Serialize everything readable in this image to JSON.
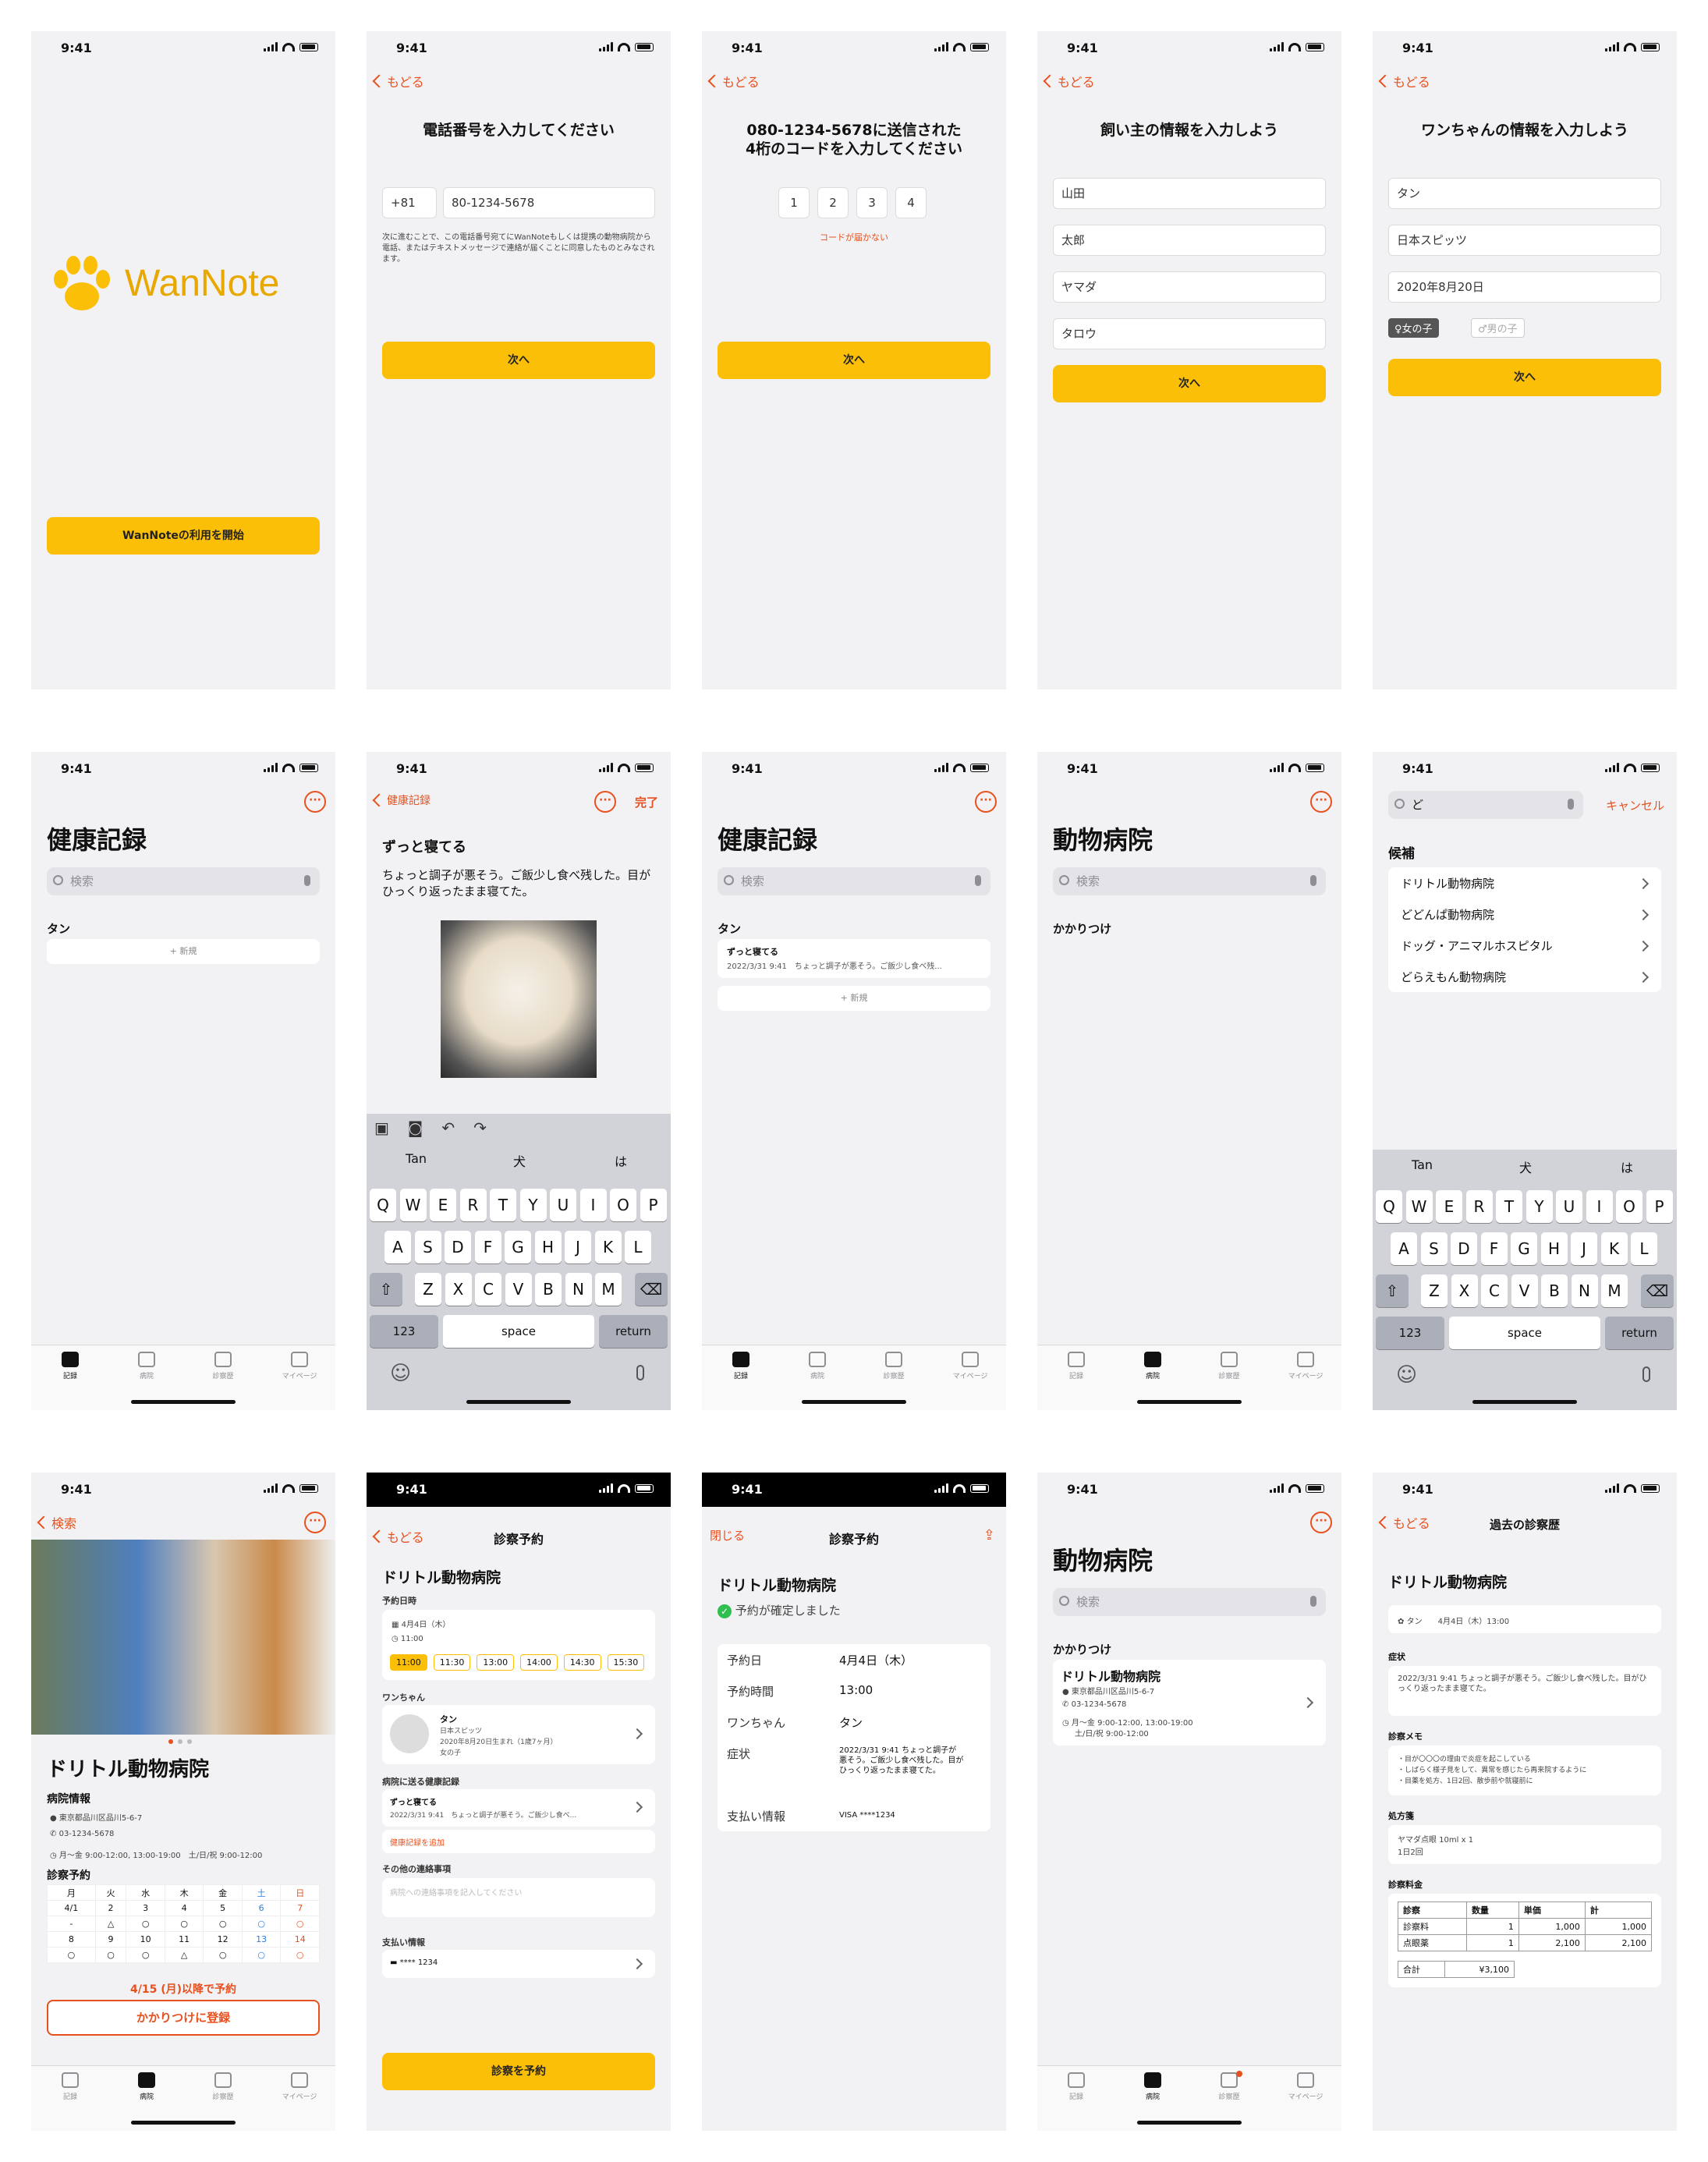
{
  "status_time": "9:41",
  "s1": {
    "logo": "WanNote",
    "start": "WanNoteの利用を開始"
  },
  "s2": {
    "back": "もどる",
    "title": "電話番号を入力してください",
    "code": "+81",
    "phone": "80-1234-5678",
    "notice": "次に進むことで、この電話番号宛てにWanNoteもしくは提携の動物病院から電話、またはテキストメッセージで連絡が届くことに同意したものとみなされます。",
    "next": "次へ"
  },
  "s3": {
    "back": "もどる",
    "title1": "080-1234-5678に送信された",
    "title2": "4桁のコードを入力してください",
    "digits": [
      "1",
      "2",
      "3",
      "4"
    ],
    "resend": "コードが届かない",
    "next": "次へ"
  },
  "s4": {
    "back": "もどる",
    "title": "飼い主の情報を入力しよう",
    "fields": [
      "山田",
      "太郎",
      "ヤマダ",
      "タロウ"
    ],
    "next": "次へ"
  },
  "s5": {
    "back": "もどる",
    "title": "ワンちゃんの情報を入力しよう",
    "fields": [
      "タン",
      "日本スピッツ",
      "2020年8月20日"
    ],
    "female": "♀女の子",
    "male": "♂男の子",
    "next": "次へ"
  },
  "tabs": [
    "記録",
    "病院",
    "診察歴",
    "マイページ"
  ],
  "s6": {
    "title": "健康記録",
    "search": "検索",
    "pet": "タン",
    "new": "+ 新規"
  },
  "s7": {
    "back": "健康記録",
    "done": "完了",
    "heading": "ずっと寝てる",
    "body": "ちょっと調子が悪そう。ご飯少し食べ残した。目がひっくり返ったまま寝てた。",
    "sugg": [
      "Tan",
      "犬",
      "は"
    ]
  },
  "kb": {
    "row1": [
      "Q",
      "W",
      "E",
      "R",
      "T",
      "Y",
      "U",
      "I",
      "O",
      "P"
    ],
    "row2": [
      "A",
      "S",
      "D",
      "F",
      "G",
      "H",
      "J",
      "K",
      "L"
    ],
    "row3": [
      "Z",
      "X",
      "C",
      "V",
      "B",
      "N",
      "M"
    ],
    "n123": "123",
    "space": "space",
    "ret": "return"
  },
  "s8": {
    "title": "健康記録",
    "search": "検索",
    "pet": "タン",
    "entry_title": "ずっと寝てる",
    "entry_meta": "2022/3/31 9:41　ちょっと調子が悪そう。ご飯少し食べ残...",
    "new": "+ 新規"
  },
  "s9": {
    "title": "動物病院",
    "search": "検索",
    "section": "かかりつけ"
  },
  "s10": {
    "query": "ど",
    "cancel": "キャンセル",
    "section": "候補",
    "items": [
      "ドリトル動物病院",
      "どどんぱ動物病院",
      "ドッグ・アニマルホスピタル",
      "どらえもん動物病院"
    ],
    "sugg": [
      "Tan",
      "犬",
      "は"
    ]
  },
  "s11": {
    "back": "検索",
    "name": "ドリトル動物病院",
    "info": "病院情報",
    "addr": "東京都品川区品川5-6-7",
    "tel": "03-1234-5678",
    "hours": "月〜金 9:00-12:00, 13:00-19:00　土/日/祝 9:00-12:00",
    "reserve": "診察予約",
    "days": [
      "月",
      "火",
      "水",
      "木",
      "金",
      "土",
      "日"
    ],
    "dates1": [
      "4/1",
      "2",
      "3",
      "4",
      "5",
      "6",
      "7"
    ],
    "dates2": [
      "8",
      "9",
      "10",
      "11",
      "12",
      "13",
      "14"
    ],
    "after": "4/15 (月)以降で予約",
    "register": "かかりつけに登録"
  },
  "s12": {
    "back": "もどる",
    "title": "診察予約",
    "name": "ドリトル動物病院",
    "date_label": "予約日時",
    "date": "4月4日（木）",
    "time": "11:00",
    "slots": [
      "11:00",
      "11:30",
      "13:00",
      "14:00",
      "14:30",
      "15:30"
    ],
    "dog_label": "ワンちゃん",
    "dog": "タン",
    "breed": "日本スピッツ",
    "birth": "2020年8月20日生まれ（1歳7ヶ月）",
    "sex": "女の子",
    "rec_label": "病院に送る健康記録",
    "rec_title": "ずっと寝てる",
    "rec_meta": "2022/3/31 9:41　ちょっと調子が悪そう。ご飯少し食べ...",
    "add_rec": "健康記録を追加",
    "other_label": "その他の連絡事項",
    "other_ph": "病院への連絡事項を記入してください",
    "pay_label": "支払い情報",
    "card": "**** 1234",
    "submit": "診察を予約"
  },
  "s13": {
    "close": "閉じる",
    "title": "診察予約",
    "name": "ドリトル動物病院",
    "confirmed": "予約が確定しました",
    "rows": [
      {
        "k": "予約日",
        "v": "4月4日（木）"
      },
      {
        "k": "予約時間",
        "v": "13:00"
      },
      {
        "k": "ワンちゃん",
        "v": "タン"
      }
    ],
    "sym_k": "症状",
    "sym_v": "2022/3/31 9:41 ちょっと調子が悪そう。ご飯少し食べ残した。目がひっくり返ったまま寝てた。",
    "pay_k": "支払い情報",
    "pay_v": "VISA ****1234"
  },
  "s14": {
    "title": "動物病院",
    "search": "検索",
    "section": "かかりつけ",
    "name": "ドリトル動物病院",
    "addr": "東京都品川区品川5-6-7",
    "tel": "03-1234-5678",
    "hours1": "月〜金 9:00-12:00, 13:00-19:00",
    "hours2": "土/日/祝 9:00-12:00"
  },
  "s15": {
    "back": "もどる",
    "title": "過去の診察歴",
    "name": "ドリトル動物病院",
    "visit": "タン　　4月4日（木）13:00",
    "sym_label": "症状",
    "sym": "2022/3/31 9:41 ちょっと調子が悪そう。ご飯少し食べ残した。目がひっくり返ったまま寝てた。",
    "memo_label": "診察メモ",
    "memo": [
      "・目が〇〇〇の理由で炎症を起こしている",
      "・しばらく様子見をして、異常を感じたら再来院するように",
      "・目薬を処方、1日2回、散歩前や就寝前に"
    ],
    "rx_label": "処方箋",
    "rx1": "ヤマダ点眼 10ml x 1",
    "rx2": "1日2回",
    "fee_label": "診察料金",
    "fee_head": [
      "診察",
      "数量",
      "単価",
      "計"
    ],
    "fee_rows": [
      [
        "診察料",
        "1",
        "1,000",
        "1,000"
      ],
      [
        "点眼薬",
        "1",
        "2,100",
        "2,100"
      ]
    ],
    "total_k": "合計",
    "total_v": "¥3,100"
  },
  "colors": {
    "accent": "#fcbf07",
    "link": "#e8501e"
  }
}
